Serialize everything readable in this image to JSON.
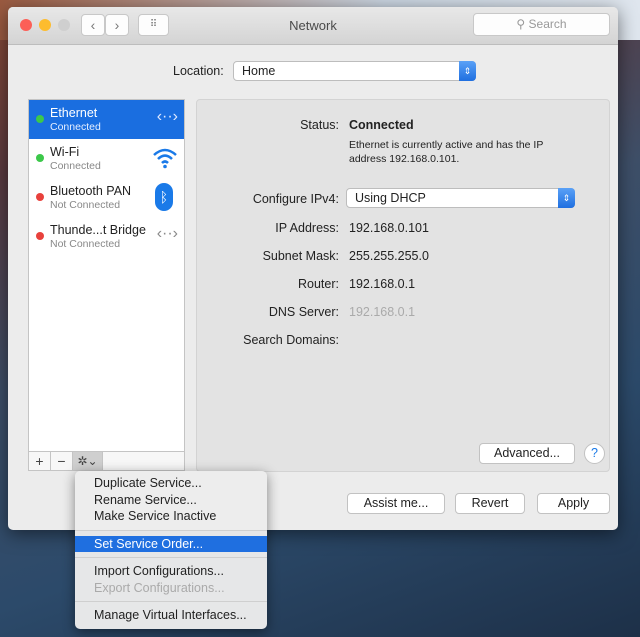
{
  "window": {
    "title": "Network",
    "search_placeholder": "Search"
  },
  "location": {
    "label": "Location:",
    "value": "Home"
  },
  "services": [
    {
      "name": "Ethernet",
      "status": "Connected",
      "dot": "#3cc84a",
      "icon": "ethernet-icon",
      "selected": true
    },
    {
      "name": "Wi-Fi",
      "status": "Connected",
      "dot": "#3cc84a",
      "icon": "wifi-icon"
    },
    {
      "name": "Bluetooth PAN",
      "status": "Not Connected",
      "dot": "#e8413c",
      "icon": "bluetooth-icon"
    },
    {
      "name": "Thunde...t Bridge",
      "status": "Not Connected",
      "dot": "#e8413c",
      "icon": "ethernet-icon"
    }
  ],
  "list_toolbar": {
    "add": "+",
    "remove": "−",
    "gear": "✲⌄"
  },
  "detail": {
    "status_label": "Status:",
    "status_value": "Connected",
    "status_desc": "Ethernet is currently active and has the IP address 192.168.0.101.",
    "configure_label": "Configure IPv4:",
    "configure_value": "Using DHCP",
    "ip_label": "IP Address:",
    "ip_value": "192.168.0.101",
    "subnet_label": "Subnet Mask:",
    "subnet_value": "255.255.255.0",
    "router_label": "Router:",
    "router_value": "192.168.0.1",
    "dns_label": "DNS Server:",
    "dns_value": "192.168.0.1",
    "search_domains_label": "Search Domains:",
    "advanced": "Advanced...",
    "help": "?"
  },
  "buttons": {
    "assist": "Assist me...",
    "revert": "Revert",
    "apply": "Apply"
  },
  "menu": [
    "Duplicate Service...",
    "Rename Service...",
    "Make Service Inactive",
    "Set Service Order...",
    "Import Configurations...",
    "Export Configurations...",
    "Manage Virtual Interfaces..."
  ]
}
